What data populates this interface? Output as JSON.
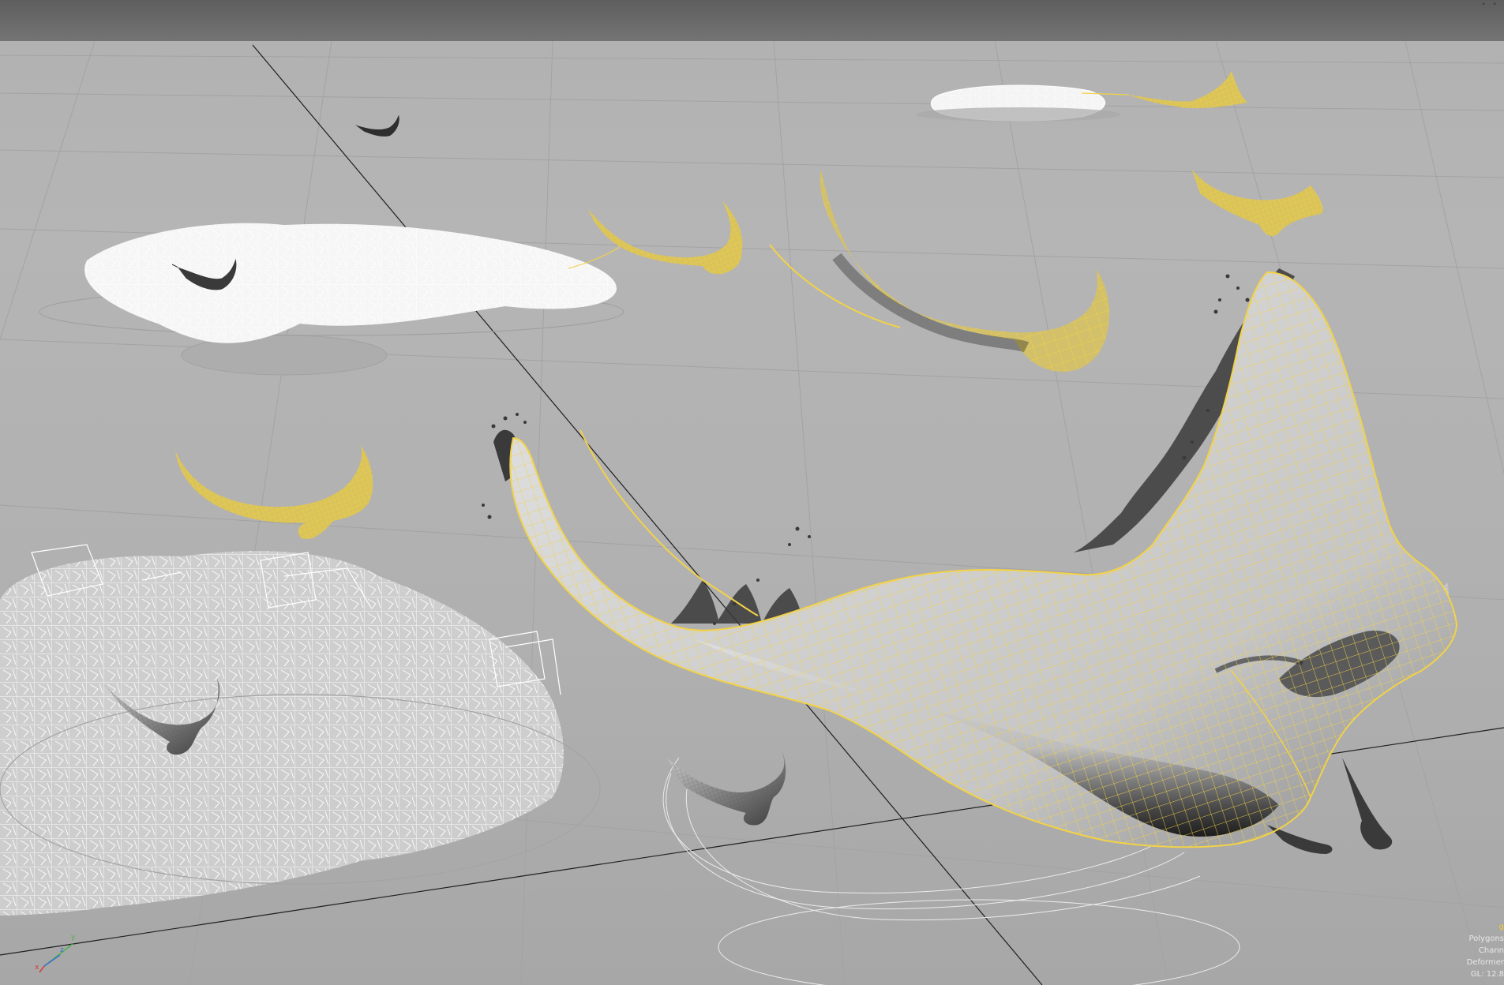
{
  "viewport": {
    "name": "3D perspective viewport",
    "background_color": "#b3b3b3",
    "topbar_color": "#6a6a6a"
  },
  "scene": {
    "selection_color": "#f2d247",
    "unselected_wire_color": "#ffffff",
    "shaded_color": "#8a8a8a",
    "selected_objects": [
      "hero-manta-ray",
      "manta-ray-upper-center",
      "manta-ray-left",
      "manta-ray-top-center",
      "manta-ray-far-right",
      "manta-ray-right"
    ],
    "particle_emitters": 3
  },
  "hud": {
    "lines": [
      "Polygons",
      "Chann",
      "Deformer",
      "GL: 12.8"
    ],
    "first_line_partial": "g"
  },
  "axis_gizmo": {
    "x_label": "x",
    "y_label": "y",
    "z_label": "z",
    "x_color": "#d63a3a",
    "y_color": "#4ab24a",
    "z_color": "#3c6fd6"
  },
  "topbar": {
    "corner_glyph": "° °"
  }
}
